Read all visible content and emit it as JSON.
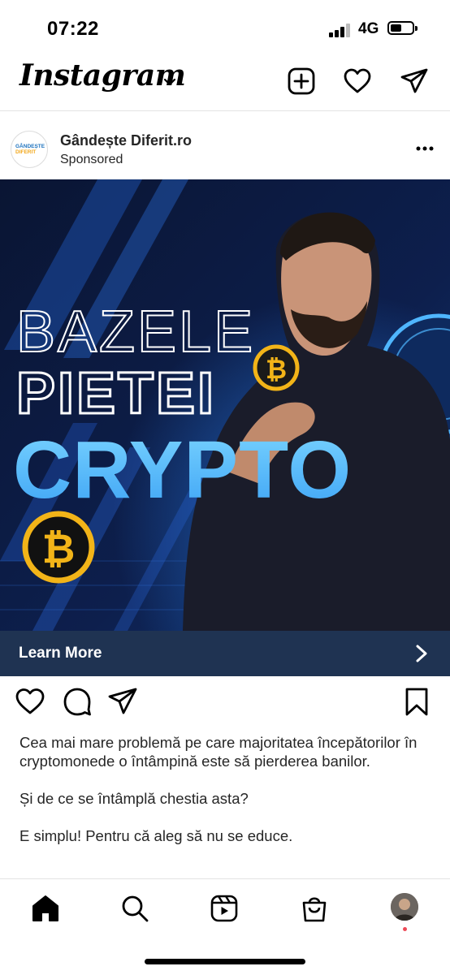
{
  "status": {
    "time": "07:22",
    "network": "4G"
  },
  "header": {
    "logo": "Instagram"
  },
  "post": {
    "username": "Gândește Diferit.ro",
    "sponsored_label": "Sponsored",
    "avatar_text": [
      "GÂNDEȘTE",
      "DIFERIT"
    ],
    "ad": {
      "line1": "BAZELE",
      "line2": "PIETEI",
      "line3": "CRYPTO"
    },
    "cta_label": "Learn More",
    "caption": [
      "Cea mai mare problemă pe care majoritatea începătorilor în cryptomonede o întâmpină este să pierderea banilor.",
      "Și de ce se întâmplă chestia asta?",
      "E simplu! Pentru că aleg să nu se educe."
    ]
  },
  "colors": {
    "cta_bg": "#1f3352",
    "ad_bg": "#0d1a3d",
    "crypto_blue": "#5cc2ff",
    "bitcoin_gold": "#f2b418",
    "notification_dot": "#ed4956"
  },
  "icons": {
    "header": [
      "chevron-down-icon",
      "new-post-icon",
      "heart-icon",
      "direct-message-icon"
    ],
    "post_actions": [
      "like-icon",
      "comment-icon",
      "share-icon",
      "save-icon"
    ],
    "tab_bar": [
      "home-icon",
      "search-icon",
      "reels-icon",
      "shop-icon",
      "profile-avatar"
    ]
  }
}
